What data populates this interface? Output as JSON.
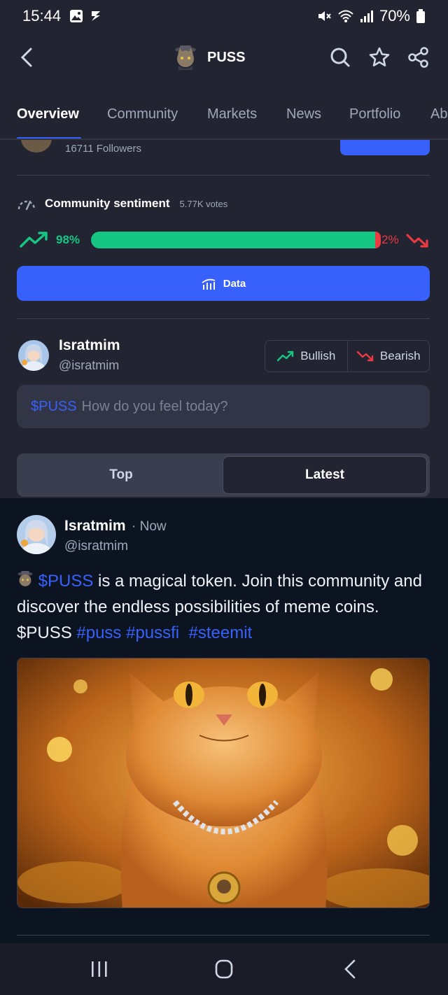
{
  "status_bar": {
    "time": "15:44",
    "battery": "70%",
    "left_icons": [
      "gallery-icon",
      "s-app-icon"
    ],
    "right_icons": [
      "mute-icon",
      "wifi-icon",
      "signal-icon",
      "battery-icon"
    ]
  },
  "header": {
    "coin_name": "PUSS",
    "actions": [
      "search-icon",
      "star-icon",
      "share-icon"
    ]
  },
  "tabs": {
    "overview": "Overview",
    "community": "Community",
    "markets": "Markets",
    "news": "News",
    "portfolio": "Portfolio",
    "about_partial": "Ab"
  },
  "followers": {
    "count_text": "16711 Followers"
  },
  "sentiment": {
    "title": "Community sentiment",
    "votes": "5.77K votes",
    "bullish_pct": "98%",
    "bearish_pct": "2%",
    "bullish_fraction": 0.98
  },
  "data_button": {
    "label": "Data"
  },
  "composer": {
    "user_name": "Isratmim",
    "user_handle": "@isratmim",
    "bullish_label": "Bullish",
    "bearish_label": "Bearish",
    "ticker": "$PUSS",
    "placeholder": "How do you feel today?"
  },
  "sort": {
    "top": "Top",
    "latest": "Latest",
    "active": "Latest"
  },
  "post": {
    "user_name": "Isratmim",
    "time": "· Now",
    "user_handle": "@isratmim",
    "ticker": "$PUSS",
    "text_1": " is a magical token. Join this community and discover the endless possibilities of meme coins. $PUSS ",
    "tags": [
      "#puss",
      "#pussfi",
      "#steemit"
    ]
  },
  "colors": {
    "background": "#222531",
    "feed_background": "#0d1421",
    "accent": "#3861fb",
    "bullish": "#16c784",
    "bearish": "#ea3943"
  }
}
